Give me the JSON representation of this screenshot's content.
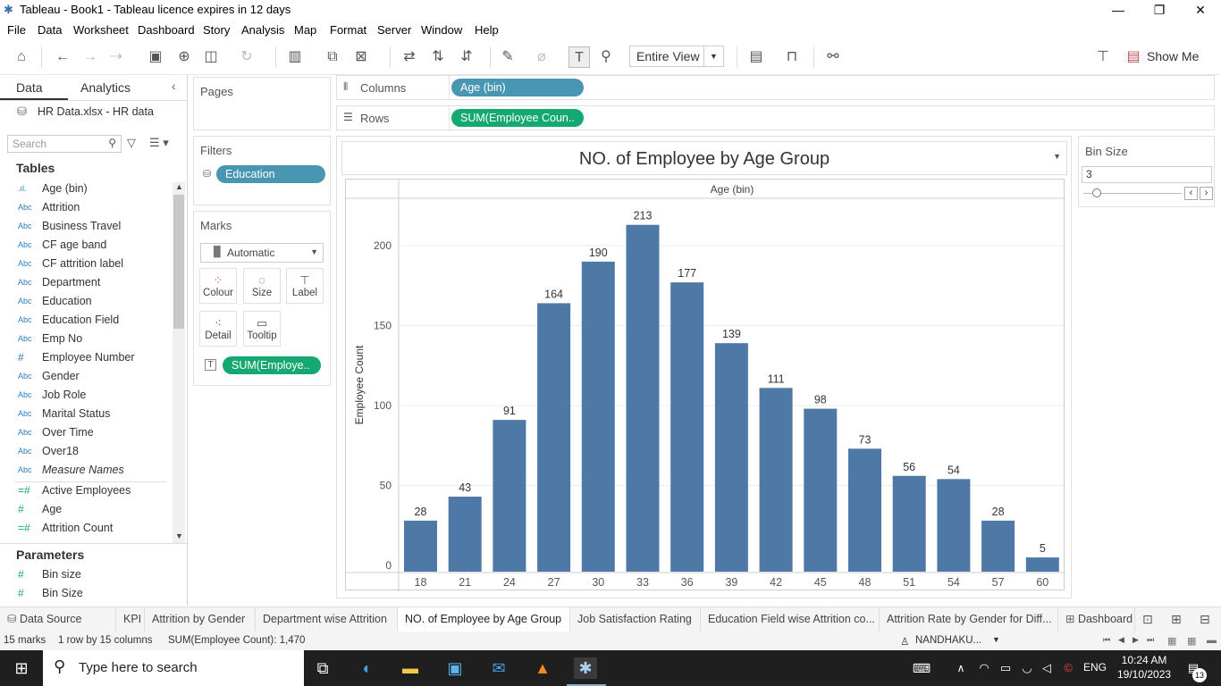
{
  "window": {
    "title": "Tableau - Book1 - Tableau licence expires in 12 days"
  },
  "menu": [
    "File",
    "Data",
    "Worksheet",
    "Dashboard",
    "Story",
    "Analysis",
    "Map",
    "Format",
    "Server",
    "Window",
    "Help"
  ],
  "toolbar": {
    "view_mode": "Entire View",
    "show_me": "Show Me"
  },
  "left_pane": {
    "tabs": {
      "data": "Data",
      "analytics": "Analytics"
    },
    "source": "HR Data.xlsx - HR data",
    "search_placeholder": "Search",
    "tables_heading": "Tables",
    "fields": [
      {
        "icon": ".ıl.",
        "name": "Age (bin)"
      },
      {
        "icon": "Abc",
        "name": "Attrition"
      },
      {
        "icon": "Abc",
        "name": "Business Travel"
      },
      {
        "icon": "Abc",
        "name": "CF age band"
      },
      {
        "icon": "Abc",
        "name": "CF attrition label"
      },
      {
        "icon": "Abc",
        "name": "Department"
      },
      {
        "icon": "Abc",
        "name": "Education"
      },
      {
        "icon": "Abc",
        "name": "Education Field"
      },
      {
        "icon": "Abc",
        "name": "Emp No"
      },
      {
        "icon": "#",
        "name": "Employee Number"
      },
      {
        "icon": "Abc",
        "name": "Gender"
      },
      {
        "icon": "Abc",
        "name": "Job Role"
      },
      {
        "icon": "Abc",
        "name": "Marital Status"
      },
      {
        "icon": "Abc",
        "name": "Over Time"
      },
      {
        "icon": "Abc",
        "name": "Over18"
      },
      {
        "icon": "Abc",
        "name": "Measure Names"
      }
    ],
    "measures": [
      {
        "icon": "=#",
        "name": "Active Employees"
      },
      {
        "icon": "#",
        "name": "Age"
      },
      {
        "icon": "=#",
        "name": "Attrition Count"
      }
    ],
    "parameters_heading": "Parameters",
    "parameters": [
      {
        "icon": "#",
        "name": "Bin size"
      },
      {
        "icon": "#",
        "name": "Bin Size"
      }
    ]
  },
  "cards": {
    "pages": "Pages",
    "filters": "Filters",
    "filter_pill": "Education",
    "marks": "Marks",
    "mark_type": "Automatic",
    "mark_buttons": [
      "Colour",
      "Size",
      "Label",
      "Detail",
      "Tooltip"
    ],
    "marks_pill": "SUM(Employe.."
  },
  "shelves": {
    "columns_label": "Columns",
    "columns_pill": "Age (bin)",
    "rows_label": "Rows",
    "rows_pill": "SUM(Employee Coun.."
  },
  "bin_size_param": {
    "title": "Bin Size",
    "value": "3"
  },
  "chart_data": {
    "type": "bar",
    "title": "NO. of Employee by Age Group",
    "header": "Age (bin)",
    "xlabel": "",
    "ylabel": "Employee Count",
    "categories": [
      "18",
      "21",
      "24",
      "27",
      "30",
      "33",
      "36",
      "39",
      "42",
      "45",
      "48",
      "51",
      "54",
      "57",
      "60"
    ],
    "values": [
      28,
      43,
      91,
      164,
      190,
      213,
      177,
      139,
      111,
      98,
      73,
      56,
      54,
      28,
      5
    ],
    "yticks": [
      0,
      50,
      100,
      150,
      200
    ],
    "ylim": [
      0,
      240
    ],
    "bar_color": "#4e79a7",
    "grid": true
  },
  "sheet_tabs": [
    "Data Source",
    "KPI",
    "Attrition by Gender",
    "Department wise Attrition",
    "NO. of Employee by Age Group",
    "Job Satisfaction Rating",
    "Education Field wise Attrition co...",
    "Attrition Rate by Gender for Diff...",
    "Dashboard"
  ],
  "active_tab": "NO. of Employee by Age Group",
  "status": {
    "marks": "15 marks",
    "dims": "1 row by 15 columns",
    "sum": "SUM(Employee Count): 1,470",
    "user": "NANDHAKU..."
  },
  "taskbar": {
    "search_placeholder": "Type here to search",
    "lang": "ENG",
    "time": "10:24 AM",
    "date": "19/10/2023",
    "notif": "13"
  }
}
